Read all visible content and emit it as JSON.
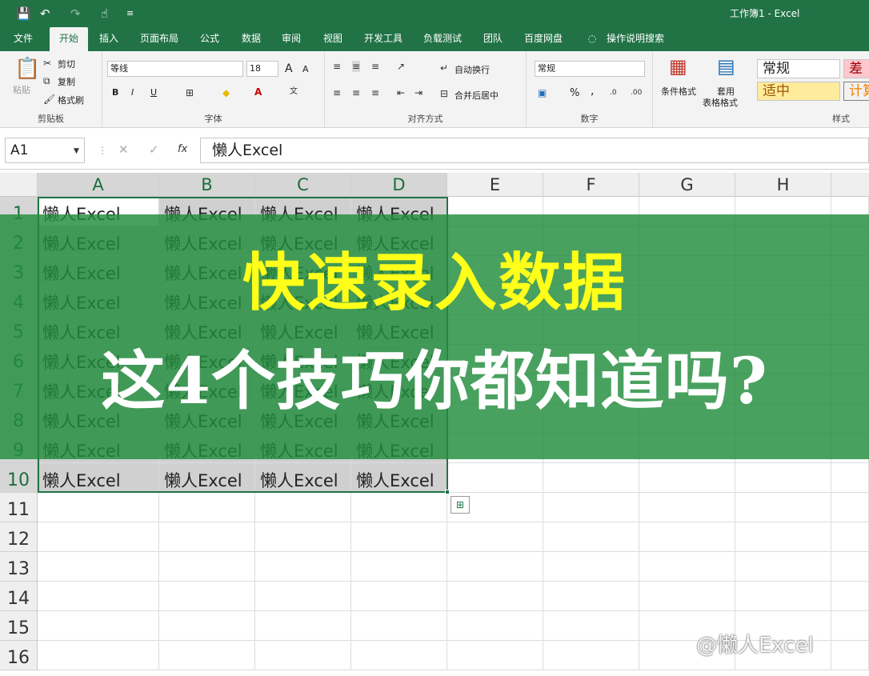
{
  "window": {
    "title": "工作簿1  -  Excel"
  },
  "quick_access": {
    "save_icon": "💾",
    "undo_icon": "↶",
    "redo_icon": "↷",
    "touch_icon": "☝",
    "customize_icon": "≡"
  },
  "tabs": [
    "文件",
    "开始",
    "插入",
    "页面布局",
    "公式",
    "数据",
    "审阅",
    "视图",
    "开发工具",
    "负载测试",
    "团队",
    "百度网盘"
  ],
  "tell_me": "操作说明搜索",
  "ribbon": {
    "clipboard": {
      "paste": "粘贴",
      "cut": "剪切",
      "copy": "复制",
      "format_painter": "格式刷",
      "label": "剪贴板"
    },
    "font": {
      "name": "等线",
      "size": "18",
      "bold": "B",
      "italic": "I",
      "underline": "U",
      "grow": "A",
      "shrink": "A",
      "label": "字体"
    },
    "alignment": {
      "wrap": "自动换行",
      "merge": "合并后居中",
      "label": "对齐方式"
    },
    "number": {
      "format": "常规",
      "percent": "%",
      "comma": ",",
      "label": "数字"
    },
    "styles": {
      "conditional": "条件格式",
      "table1": "套用",
      "table2": "表格格式",
      "normal": "常规",
      "bad": "差",
      "neutral": "适中",
      "calc": "计算",
      "label": "样式"
    }
  },
  "formula_bar": {
    "name_box": "A1",
    "cancel": "✕",
    "enter": "✓",
    "fx": "fx",
    "value": "懒人Excel"
  },
  "columns": [
    "A",
    "B",
    "C",
    "D",
    "E",
    "F",
    "G",
    "H"
  ],
  "rows": [
    "1",
    "2",
    "3",
    "4",
    "5",
    "6",
    "7",
    "8",
    "9",
    "10",
    "11",
    "12",
    "13",
    "14",
    "15",
    "16"
  ],
  "cell_text": "懒人Excel",
  "banner": {
    "line1": "快速录入数据",
    "line2": "这4个技巧你都知道吗?"
  },
  "watermark": "@懒人Excel"
}
